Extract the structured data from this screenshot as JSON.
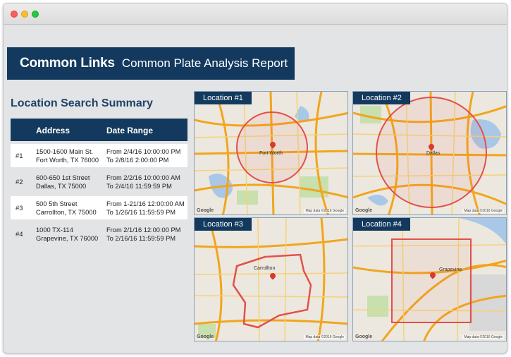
{
  "header": {
    "app_name": "Common Links",
    "report_title": "Common Plate Analysis Report"
  },
  "summary": {
    "title": "Location Search Summary",
    "columns": {
      "address": "Address",
      "date_range": "Date Range"
    },
    "rows": [
      {
        "num": "#1",
        "address1": "1500-1600 Main St.",
        "address2": "Fort Worth, TX 76000",
        "from": "From 2/4/16 10:00:00 PM",
        "to": "To 2/8/16 2:00:00 PM"
      },
      {
        "num": "#2",
        "address1": "600-650 1st Street",
        "address2": "Dallas, TX 75000",
        "from": "From 2/2/16 10:00:00 AM",
        "to": "To 2/4/16 11:59:59 PM"
      },
      {
        "num": "#3",
        "address1": "500 5th Street",
        "address2": "Carrollton, TX 75000",
        "from": "From 1-21/16 12:00:00 AM",
        "to": "To 1/26/16 11:59:59 PM"
      },
      {
        "num": "#4",
        "address1": "1000 TX-114",
        "address2": "Grapevine, TX 76000",
        "from": "From 2/1/16 12:00:00 PM",
        "to": "To 2/16/16 11:59:59 PM"
      }
    ]
  },
  "maps": [
    {
      "label": "Location #1",
      "city": "Fort Worth",
      "shape": "circle"
    },
    {
      "label": "Location #2",
      "city": "Dallas",
      "shape": "circle"
    },
    {
      "label": "Location #3",
      "city": "Carrollton",
      "shape": "polygon"
    },
    {
      "label": "Location #4",
      "city": "Grapevine",
      "shape": "rectangle"
    }
  ],
  "map_attribution": {
    "google": "Google",
    "data": "Map data ©2016 Google"
  },
  "colors": {
    "navy": "#133a5e",
    "highway": "#f2a51d",
    "search_area": "#e2504a",
    "water": "#a9c8e8",
    "park": "#c8dfae"
  }
}
